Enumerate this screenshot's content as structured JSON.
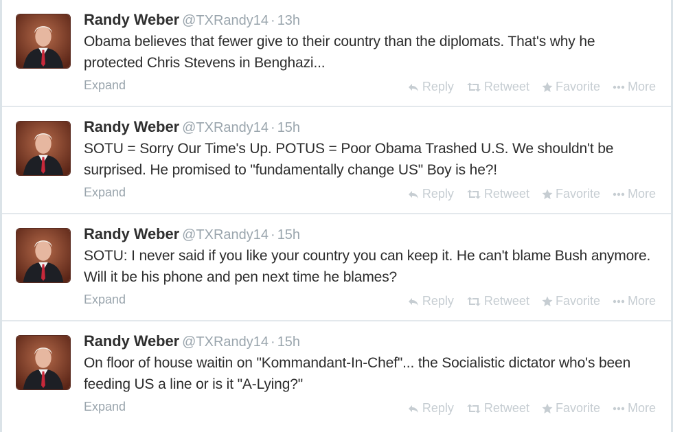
{
  "tweets": [
    {
      "name": "Randy Weber",
      "handle": "@TXRandy14",
      "separator": "·",
      "time": "13h",
      "text": "Obama believes that fewer give to their country than the diplomats. That's why he protected Chris Stevens in Benghazi...",
      "expand": "Expand"
    },
    {
      "name": "Randy Weber",
      "handle": "@TXRandy14",
      "separator": "·",
      "time": "15h",
      "text": "SOTU = Sorry Our Time's Up. POTUS = Poor Obama Trashed U.S. We shouldn't be surprised. He promised to \"fundamentally change US\" Boy is he?!",
      "expand": "Expand"
    },
    {
      "name": "Randy Weber",
      "handle": "@TXRandy14",
      "separator": "·",
      "time": "15h",
      "text": "SOTU: I never said if you like your country you can keep it. He can't blame Bush anymore. Will it be his phone and pen next time he blames?",
      "expand": "Expand"
    },
    {
      "name": "Randy Weber",
      "handle": "@TXRandy14",
      "separator": "·",
      "time": "15h",
      "text": "On floor of house waitin on \"Kommandant-In-Chef\"... the Socialistic dictator who's been feeding US a line or is it \"A-Lying?\"",
      "expand": "Expand"
    }
  ],
  "actions": {
    "reply": "Reply",
    "retweet": "Retweet",
    "favorite": "Favorite",
    "more": "More"
  },
  "icons": {
    "reply": "reply-arrow-icon",
    "retweet": "retweet-icon",
    "favorite": "star-icon",
    "more": "ellipsis-icon"
  },
  "colors": {
    "name": "#2f2f2f",
    "meta": "#9aa5ad",
    "action": "#c6cdd2",
    "divider": "#e3e8ec"
  }
}
